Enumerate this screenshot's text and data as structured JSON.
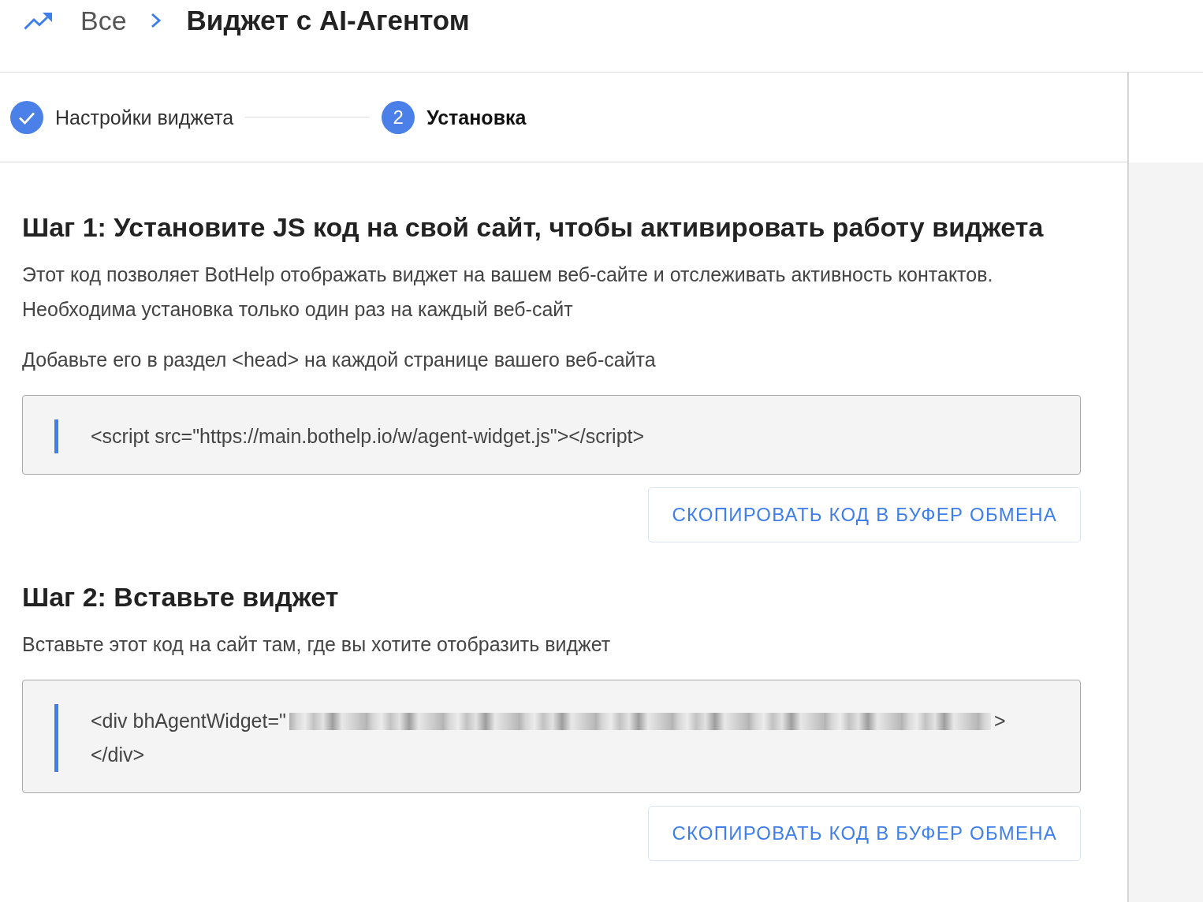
{
  "header": {
    "breadcrumb_root": "Все",
    "title": "Виджет с AI-Агентом"
  },
  "stepper": {
    "steps": [
      {
        "label": "Настройки виджета",
        "completed": true,
        "selected": false
      },
      {
        "number": "2",
        "label": "Установка",
        "completed": false,
        "selected": true
      }
    ]
  },
  "sections": [
    {
      "title": "Шаг 1: Установите JS код на свой сайт, чтобы активировать работу виджета",
      "description": [
        "Этот код позволяет BotHelp отображать виджет на вашем веб-сайте и отслеживать активность контактов.",
        "Необходима установка только один раз на каждый веб-сайт"
      ],
      "instruction": "Добавьте его в раздел <head> на каждой странице вашего веб-сайта",
      "code": {
        "lines": [
          [
            {
              "kind": "text",
              "text": "<script src=\"https://main.bothelp.io/w/agent-widget.js\"></script>"
            }
          ]
        ]
      },
      "button": "СКОПИРОВАТЬ КОД В БУФЕР ОБМЕНА"
    },
    {
      "title": "Шаг 2: Вставьте виджет",
      "description": [
        "Вставьте этот код на сайт там, где вы хотите отобразить виджет"
      ],
      "code": {
        "lines": [
          [
            {
              "kind": "text",
              "text": "<div bhAgentWidget=\""
            },
            {
              "kind": "redacted"
            },
            {
              "kind": "text",
              "text": ">"
            }
          ],
          [
            {
              "kind": "text",
              "text": "</div>"
            }
          ]
        ]
      },
      "button": "СКОПИРОВАТЬ КОД В БУФЕР ОБМЕНА"
    }
  ]
}
